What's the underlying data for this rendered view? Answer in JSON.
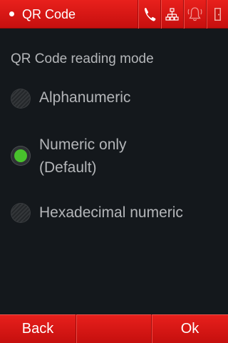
{
  "header": {
    "title": "QR Code",
    "icons": [
      "phone-icon",
      "network-icon",
      "alarm-icon",
      "exit-icon"
    ],
    "accent_color": "#d8160f"
  },
  "main": {
    "section_title": "QR Code reading mode",
    "options": [
      {
        "line1": "Alphanumeric",
        "line2": "",
        "selected": false
      },
      {
        "line1": "Numeric only",
        "line2": "(Default)",
        "selected": true
      },
      {
        "line1": "Hexadecimal numeric",
        "line2": "",
        "selected": false
      }
    ],
    "selected_color": "#48c22c"
  },
  "footer": {
    "back_label": "Back",
    "middle_label": "",
    "ok_label": "Ok"
  }
}
